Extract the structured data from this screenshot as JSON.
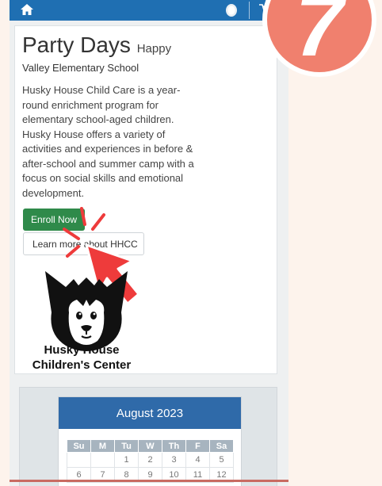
{
  "header": {
    "home_icon": "home-icon",
    "user_icon": "user-icon",
    "cart_icon": "cart-icon",
    "color": "#1f6fb2"
  },
  "hero": {
    "title": "Party Days",
    "title_small": "Happy",
    "subtitle": "Valley Elementary School",
    "description": "Husky House Child Care is a year-round enrichment program for elementary school-aged children. Husky House offers a variety of activities and experiences in before & after-school and summer camp with a focus on social skills and emotional development.",
    "enroll_label": "Enroll Now",
    "learn_label": "Learn more about HHCC",
    "enroll_color": "#2f8a4a"
  },
  "brand": {
    "line1": "Husky House",
    "line2": "Children's Center"
  },
  "calendar": {
    "month": "August 2023",
    "weekdays": [
      "Su",
      "M",
      "Tu",
      "W",
      "Th",
      "F",
      "Sa"
    ],
    "weeks": [
      [
        "",
        "",
        "1",
        "2",
        "3",
        "4",
        "5"
      ],
      [
        "6",
        "7",
        "8",
        "9",
        "10",
        "11",
        "12"
      ]
    ],
    "header_color": "#2f6aa9"
  },
  "overlay": {
    "step_number": "7",
    "badge_color": "#f0806e",
    "pointer_color": "#ee3b3b"
  }
}
